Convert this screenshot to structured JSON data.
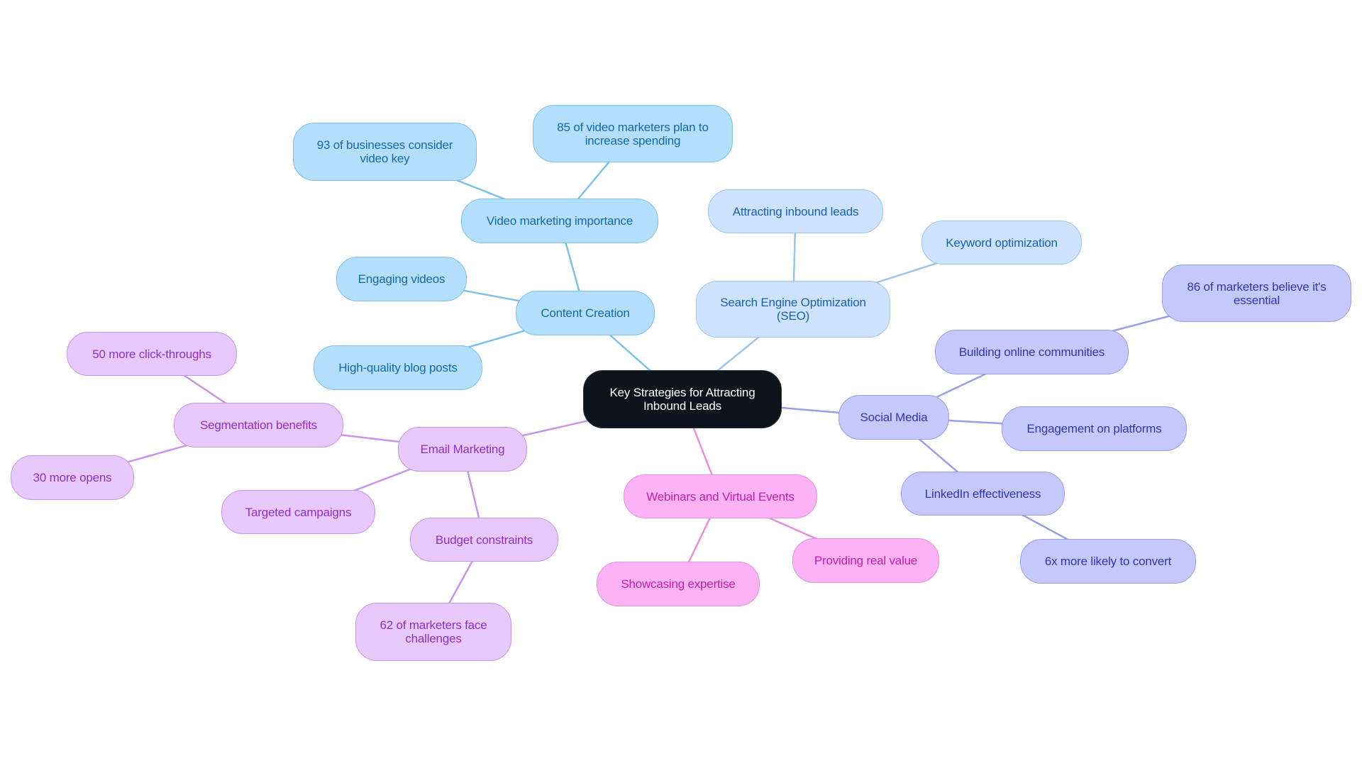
{
  "title": "Key Strategies for Attracting Inbound Leads",
  "colors": {
    "root": "#0d141b",
    "content": "#b3defc",
    "seo": "#cde3fb",
    "social": "#c5c8fb",
    "webinar": "#fbb3f5",
    "email": "#e8c9fc",
    "edge_content": "#7ec1e8",
    "edge_seo": "#9dc3ee",
    "edge_social": "#9a9ee6",
    "edge_webinar": "#e68fdc",
    "edge_email": "#c794eb"
  },
  "mindmap": {
    "root": "Key Strategies for Attracting Inbound Leads",
    "branches": [
      {
        "label": "Content Creation",
        "children": [
          {
            "label": "Video marketing importance",
            "children": [
              {
                "label": "93 of businesses consider video key"
              },
              {
                "label": "85 of video marketers plan to increase spending"
              }
            ]
          },
          {
            "label": "Engaging videos"
          },
          {
            "label": "High-quality blog posts"
          }
        ]
      },
      {
        "label": "Search Engine Optimization (SEO)",
        "children": [
          {
            "label": "Attracting inbound leads"
          },
          {
            "label": "Keyword optimization"
          }
        ]
      },
      {
        "label": "Social Media",
        "children": [
          {
            "label": "Building online communities",
            "children": [
              {
                "label": "86 of marketers believe it's essential"
              }
            ]
          },
          {
            "label": "Engagement on platforms"
          },
          {
            "label": "LinkedIn effectiveness",
            "children": [
              {
                "label": "6x more likely to convert"
              }
            ]
          }
        ]
      },
      {
        "label": "Webinars and Virtual Events",
        "children": [
          {
            "label": "Showcasing expertise"
          },
          {
            "label": "Providing real value"
          }
        ]
      },
      {
        "label": "Email Marketing",
        "children": [
          {
            "label": "Segmentation benefits",
            "children": [
              {
                "label": "50 more click-throughs"
              },
              {
                "label": "30 more opens"
              }
            ]
          },
          {
            "label": "Targeted campaigns"
          },
          {
            "label": "Budget constraints",
            "children": [
              {
                "label": "62 of marketers face challenges"
              }
            ]
          }
        ]
      }
    ]
  },
  "nodes": {
    "root": [
      "Key Strategies for Attracting",
      "Inbound Leads"
    ],
    "content_creation": [
      "Content Creation"
    ],
    "video_marketing": [
      "Video marketing importance"
    ],
    "businesses_93": [
      "93 of businesses consider",
      "video key"
    ],
    "video_marketers_85": [
      "85 of video marketers plan to",
      "increase spending"
    ],
    "engaging_videos": [
      "Engaging videos"
    ],
    "blog_posts": [
      "High-quality blog posts"
    ],
    "seo": [
      "Search Engine Optimization",
      "(SEO)"
    ],
    "attracting_leads": [
      "Attracting inbound leads"
    ],
    "keyword_opt": [
      "Keyword optimization"
    ],
    "social_media": [
      "Social Media"
    ],
    "online_communities": [
      "Building online communities"
    ],
    "marketers_86": [
      "86 of marketers believe it's",
      "essential"
    ],
    "engagement_platforms": [
      "Engagement on platforms"
    ],
    "linkedin": [
      "LinkedIn effectiveness"
    ],
    "convert_6x": [
      "6x more likely to convert"
    ],
    "webinars": [
      "Webinars and Virtual Events"
    ],
    "showcasing": [
      "Showcasing expertise"
    ],
    "real_value": [
      "Providing real value"
    ],
    "email_marketing": [
      "Email Marketing"
    ],
    "segmentation": [
      "Segmentation benefits"
    ],
    "clickthroughs_50": [
      "50 more click-throughs"
    ],
    "opens_30": [
      "30 more opens"
    ],
    "targeted": [
      "Targeted campaigns"
    ],
    "budget": [
      "Budget constraints"
    ],
    "marketers_62": [
      "62 of marketers face",
      "challenges"
    ]
  }
}
